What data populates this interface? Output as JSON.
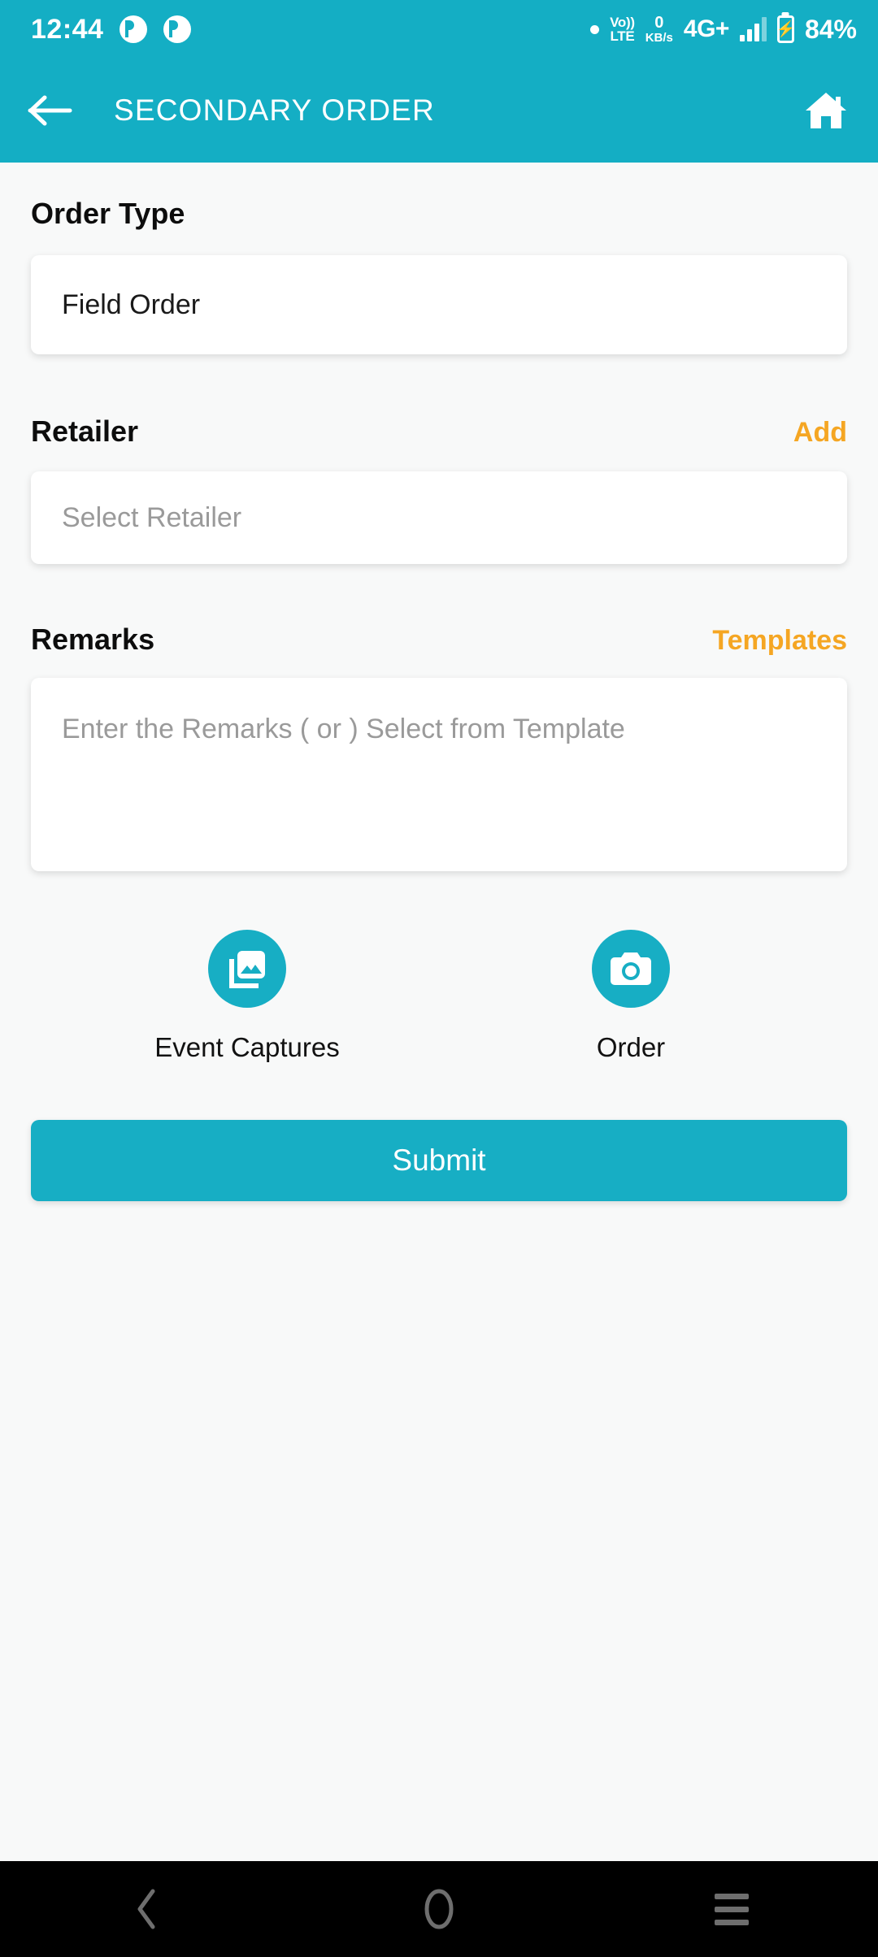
{
  "status_bar": {
    "time": "12:44",
    "notification_icons": [
      "notification-circle-icon",
      "notification-circle-icon"
    ],
    "connectivity": {
      "volte_top": "Vo))",
      "volte_bottom": "LTE",
      "data_rate_value": "0",
      "data_rate_unit": "KB/s",
      "network": "4G+"
    },
    "battery_percent": "84%",
    "bar_color": "#14aec4"
  },
  "app_bar": {
    "title": "SECONDARY ORDER",
    "back_icon": "arrow-left-icon",
    "home_icon": "home-icon",
    "background": "#14aec4"
  },
  "form": {
    "order_type": {
      "label": "Order Type",
      "value": "Field Order"
    },
    "retailer": {
      "label": "Retailer",
      "action_label": "Add",
      "placeholder": "Select Retailer",
      "value": ""
    },
    "remarks": {
      "label": "Remarks",
      "action_label": "Templates",
      "placeholder": "Enter the Remarks ( or ) Select from Template",
      "value": ""
    }
  },
  "actions": [
    {
      "label": "Event Captures",
      "icon": "photo-library-icon"
    },
    {
      "label": "Order",
      "icon": "camera-icon"
    }
  ],
  "submit": {
    "label": "Submit",
    "color": "#17aec4"
  },
  "nav_bar": {
    "back_icon": "chevron-left-icon",
    "home_icon": "circle-home-icon",
    "recents_icon": "hamburger-recents-icon"
  },
  "theme": {
    "primary": "#14aec4",
    "accent": "#f5a623",
    "page_background": "#f8f9f9",
    "card_background": "#ffffff"
  }
}
